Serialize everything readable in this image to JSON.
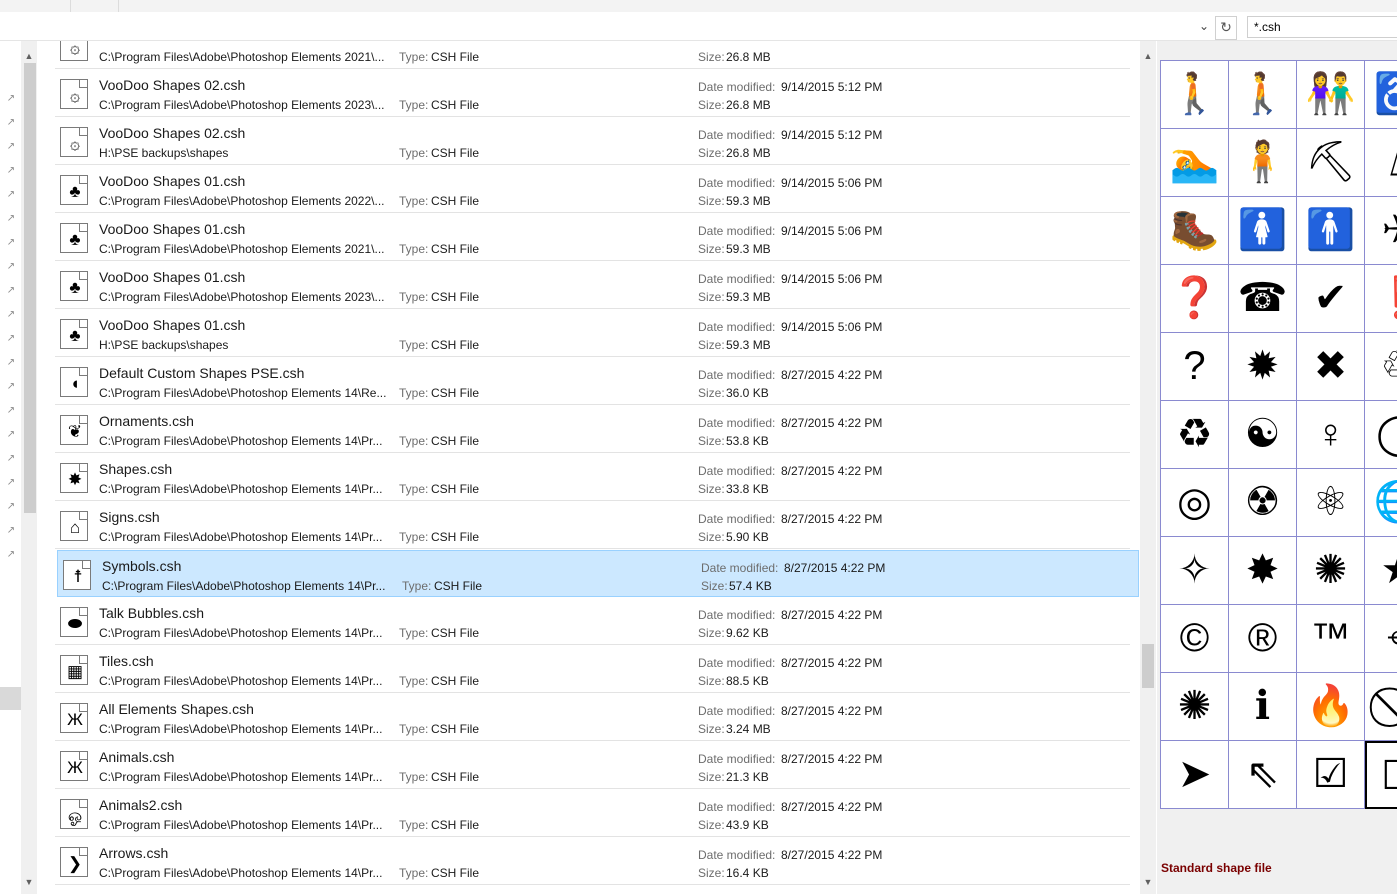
{
  "filter": {
    "value": "*.csh",
    "dropdown_icon": "chevron-down-icon",
    "refresh_icon": "refresh-icon"
  },
  "labels": {
    "type": "Type:",
    "date_modified": "Date modified:",
    "size": "Size:"
  },
  "files": [
    {
      "name": "",
      "path": "C:\\Program Files\\Adobe\\Photoshop Elements 2021\\...",
      "type": "CSH File",
      "date": "",
      "size": "26.8 MB",
      "icon": "voodoo-swirl-icon",
      "glyph": "۞"
    },
    {
      "name": "VooDoo Shapes 02.csh",
      "path": "C:\\Program Files\\Adobe\\Photoshop Elements 2023\\...",
      "type": "CSH File",
      "date": "9/14/2015 5:12 PM",
      "size": "26.8 MB",
      "icon": "voodoo-swirl-icon",
      "glyph": "۞"
    },
    {
      "name": "VooDoo Shapes 02.csh",
      "path": "H:\\PSE backups\\shapes",
      "type": "CSH File",
      "date": "9/14/2015 5:12 PM",
      "size": "26.8 MB",
      "icon": "voodoo-swirl-icon",
      "glyph": "۞"
    },
    {
      "name": "VooDoo Shapes 01.csh",
      "path": "C:\\Program Files\\Adobe\\Photoshop Elements 2022\\...",
      "type": "CSH File",
      "date": "9/14/2015 5:06 PM",
      "size": "59.3 MB",
      "icon": "tree-icon",
      "glyph": "♣"
    },
    {
      "name": "VooDoo Shapes 01.csh",
      "path": "C:\\Program Files\\Adobe\\Photoshop Elements 2021\\...",
      "type": "CSH File",
      "date": "9/14/2015 5:06 PM",
      "size": "59.3 MB",
      "icon": "tree-icon",
      "glyph": "♣"
    },
    {
      "name": "VooDoo Shapes 01.csh",
      "path": "C:\\Program Files\\Adobe\\Photoshop Elements 2023\\...",
      "type": "CSH File",
      "date": "9/14/2015 5:06 PM",
      "size": "59.3 MB",
      "icon": "tree-icon",
      "glyph": "♣"
    },
    {
      "name": "VooDoo Shapes 01.csh",
      "path": "H:\\PSE backups\\shapes",
      "type": "CSH File",
      "date": "9/14/2015 5:06 PM",
      "size": "59.3 MB",
      "icon": "tree-icon",
      "glyph": "♣"
    },
    {
      "name": "Default Custom Shapes PSE.csh",
      "path": "C:\\Program Files\\Adobe\\Photoshop Elements 14\\Re...",
      "type": "CSH File",
      "date": "8/27/2015 4:22 PM",
      "size": "36.0 KB",
      "icon": "fish-icon",
      "glyph": "◖"
    },
    {
      "name": "Ornaments.csh",
      "path": "C:\\Program Files\\Adobe\\Photoshop Elements 14\\Pr...",
      "type": "CSH File",
      "date": "8/27/2015 4:22 PM",
      "size": "53.8 KB",
      "icon": "ornament-icon",
      "glyph": "❦"
    },
    {
      "name": "Shapes.csh",
      "path": "C:\\Program Files\\Adobe\\Photoshop Elements 14\\Pr...",
      "type": "CSH File",
      "date": "8/27/2015 4:22 PM",
      "size": "33.8 KB",
      "icon": "starburst-icon",
      "glyph": "✸"
    },
    {
      "name": "Signs.csh",
      "path": "C:\\Program Files\\Adobe\\Photoshop Elements 14\\Pr...",
      "type": "CSH File",
      "date": "8/27/2015 4:22 PM",
      "size": "5.90 KB",
      "icon": "house-icon",
      "glyph": "⌂"
    },
    {
      "name": "Symbols.csh",
      "path": "C:\\Program Files\\Adobe\\Photoshop Elements 14\\Pr...",
      "type": "CSH File",
      "date": "8/27/2015 4:22 PM",
      "size": "57.4 KB",
      "icon": "walking-person-icon",
      "glyph": "☨",
      "selected": true
    },
    {
      "name": "Talk Bubbles.csh",
      "path": "C:\\Program Files\\Adobe\\Photoshop Elements 14\\Pr...",
      "type": "CSH File",
      "date": "8/27/2015 4:22 PM",
      "size": "9.62 KB",
      "icon": "speech-bubble-icon",
      "glyph": "⬬"
    },
    {
      "name": "Tiles.csh",
      "path": "C:\\Program Files\\Adobe\\Photoshop Elements 14\\Pr...",
      "type": "CSH File",
      "date": "8/27/2015 4:22 PM",
      "size": "88.5 KB",
      "icon": "tiles-icon",
      "glyph": "▦"
    },
    {
      "name": "All Elements Shapes.csh",
      "path": "C:\\Program Files\\Adobe\\Photoshop Elements 14\\Pr...",
      "type": "CSH File",
      "date": "8/27/2015 4:22 PM",
      "size": "3.24 MB",
      "icon": "butterfly-icon",
      "glyph": "Ж"
    },
    {
      "name": "Animals.csh",
      "path": "C:\\Program Files\\Adobe\\Photoshop Elements 14\\Pr...",
      "type": "CSH File",
      "date": "8/27/2015 4:22 PM",
      "size": "21.3 KB",
      "icon": "butterfly-icon",
      "glyph": "Ж"
    },
    {
      "name": "Animals2.csh",
      "path": "C:\\Program Files\\Adobe\\Photoshop Elements 14\\Pr...",
      "type": "CSH File",
      "date": "8/27/2015 4:22 PM",
      "size": "43.9 KB",
      "icon": "animal-outline-icon",
      "glyph": "ஓ"
    },
    {
      "name": "Arrows.csh",
      "path": "C:\\Program Files\\Adobe\\Photoshop Elements 14\\Pr...",
      "type": "CSH File",
      "date": "8/27/2015 4:22 PM",
      "size": "16.4 KB",
      "icon": "arrow-icon",
      "glyph": "❯"
    }
  ],
  "preview": {
    "label": "Standard shape file",
    "shapes": [
      {
        "icon": "walking-man-icon",
        "glyph": "🚶"
      },
      {
        "icon": "pedestrian-icon",
        "glyph": "🚶"
      },
      {
        "icon": "couple-icon",
        "glyph": "👫"
      },
      {
        "icon": "wheelchair-icon",
        "glyph": "♿"
      },
      {
        "icon": "swimmer-icon",
        "glyph": "🏊"
      },
      {
        "icon": "teacher-icon",
        "glyph": "🧍"
      },
      {
        "icon": "worker-shovel-icon",
        "glyph": "⛏"
      },
      {
        "icon": "surveyor-icon",
        "glyph": "⍋"
      },
      {
        "icon": "hiker-icon",
        "glyph": "🥾"
      },
      {
        "icon": "woman-icon",
        "glyph": "🚺"
      },
      {
        "icon": "man-icon",
        "glyph": "🚹"
      },
      {
        "icon": "airplane-icon",
        "glyph": "✈"
      },
      {
        "icon": "question-box-icon",
        "glyph": "❓"
      },
      {
        "icon": "telephone-box-icon",
        "glyph": "☎"
      },
      {
        "icon": "checkmark-icon",
        "glyph": "✔"
      },
      {
        "icon": "exclamation-icon",
        "glyph": "❗"
      },
      {
        "icon": "question-mark-icon",
        "glyph": "?"
      },
      {
        "icon": "burst-icon",
        "glyph": "✹"
      },
      {
        "icon": "x-mark-icon",
        "glyph": "✖"
      },
      {
        "icon": "recycle-outline-icon",
        "glyph": "♲"
      },
      {
        "icon": "recycle-icon",
        "glyph": "♻"
      },
      {
        "icon": "yin-yang-icon",
        "glyph": "☯"
      },
      {
        "icon": "female-symbol-icon",
        "glyph": "♀"
      },
      {
        "icon": "male-symbol-icon",
        "glyph": "◯"
      },
      {
        "icon": "target-icon",
        "glyph": "◎"
      },
      {
        "icon": "radiation-icon",
        "glyph": "☢"
      },
      {
        "icon": "atom-icon",
        "glyph": "⚛"
      },
      {
        "icon": "globe-icon",
        "glyph": "🌐"
      },
      {
        "icon": "compass-icon",
        "glyph": "✧"
      },
      {
        "icon": "explosion-icon",
        "glyph": "✸"
      },
      {
        "icon": "starburst-outline-icon",
        "glyph": "✺"
      },
      {
        "icon": "star-icon",
        "glyph": "★"
      },
      {
        "icon": "copyright-icon",
        "glyph": "©"
      },
      {
        "icon": "registered-icon",
        "glyph": "®"
      },
      {
        "icon": "trademark-icon",
        "glyph": "™"
      },
      {
        "icon": "crosshair-icon",
        "glyph": "⌖"
      },
      {
        "icon": "sunburst-icon",
        "glyph": "✺"
      },
      {
        "icon": "info-icon",
        "glyph": "ℹ"
      },
      {
        "icon": "campfire-icon",
        "glyph": "🔥"
      },
      {
        "icon": "prohibited-icon",
        "glyph": "⃠"
      },
      {
        "icon": "cursor-arrow-icon",
        "glyph": "➤"
      },
      {
        "icon": "cursor-outline-icon",
        "glyph": "⇖"
      },
      {
        "icon": "checkbox-checked-icon",
        "glyph": "☑"
      },
      {
        "icon": "checkbox-empty-icon",
        "glyph": "☐"
      }
    ]
  },
  "nav_pins": 20
}
